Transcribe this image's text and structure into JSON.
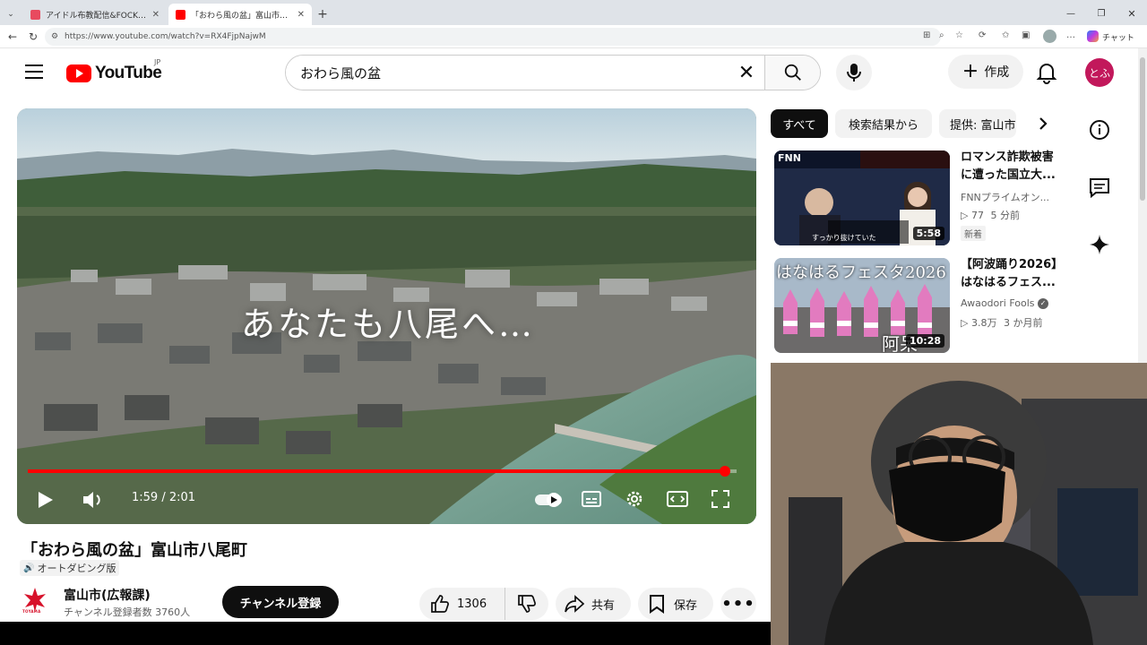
{
  "browser": {
    "tabs": [
      {
        "title": "アイドル布教配信&FOCKニュース [日",
        "active": false
      },
      {
        "title": "「おわら風の盆」富山市八尾町 - You",
        "active": true
      }
    ],
    "url": "https://www.youtube.com/watch?v=RX4FjpNajwM",
    "copilot_label": "チャット"
  },
  "header": {
    "logo_text": "YouTube",
    "region": "JP",
    "search_value": "おわら風の盆",
    "create_label": "作成",
    "avatar_text": "とふ"
  },
  "player": {
    "overlay_text": "あなたも八尾へ…",
    "current_time": "1:59",
    "duration": "2:01",
    "time_display": "1:59 / 2:01",
    "progress": 0.983
  },
  "video": {
    "title": "「おわら風の盆」富山市八尾町",
    "dub_label": "オートダビング版",
    "channel_name": "富山市(広報課)",
    "channel_subs": "チャンネル登録者数 3760人",
    "subscribe_label": "チャンネル登録",
    "likes": "1306",
    "share_label": "共有",
    "save_label": "保存",
    "channel_logo_text": "TOYAMA"
  },
  "chips": [
    {
      "label": "すべて",
      "active": true
    },
    {
      "label": "検索結果から",
      "active": false
    },
    {
      "label": "提供: 富山市",
      "active": false
    }
  ],
  "recommendations": [
    {
      "title": "ロマンス詐欺被害に遭った国立大...",
      "channel": "FNNプライムオン...",
      "views": "77",
      "age": "5 分前",
      "badge": "新着",
      "duration": "5:58",
      "thumb_brand": "FNN",
      "thumb_caption": "すっかり抜けていた"
    },
    {
      "title": "【阿波踊り2026】はなはるフェス...",
      "channel": "Awaodori Fools",
      "views": "3.8万",
      "age": "3 か月前",
      "badge": "",
      "duration": "10:28",
      "thumb_caption": "はなはるフェスタ2026",
      "thumb_caption2": "阿呆"
    }
  ],
  "colors": {
    "youtube_red": "#ff0000",
    "chip_active": "#0f0f0f",
    "avatar": "#c2185b"
  }
}
